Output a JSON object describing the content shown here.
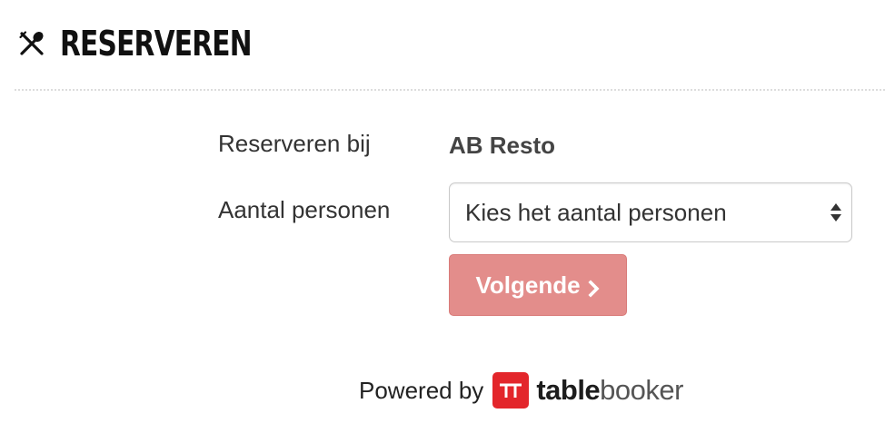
{
  "header": {
    "icon": "utensils-icon",
    "title": "RESERVEREN"
  },
  "form": {
    "restaurant_label": "Reserveren bij",
    "restaurant_value": "AB Resto",
    "persons_label": "Aantal personen",
    "persons_select": {
      "selected": "Kies het aantal personen",
      "icon": "select-arrows-icon"
    },
    "next_button": {
      "label": "Volgende",
      "icon": "chevron-right-icon",
      "color": "#e38d8b"
    }
  },
  "footer": {
    "powered_text": "Powered by",
    "logo_icon": "tablebooker-logo-icon",
    "brand_bold": "table",
    "brand_regular": "booker",
    "brand_color": "#e3262b"
  }
}
